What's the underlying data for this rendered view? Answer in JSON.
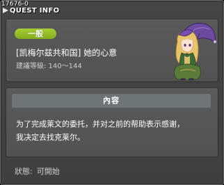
{
  "window": {
    "quest_id": "17676-0",
    "title": "QUEST INFO"
  },
  "info": {
    "category": "一般",
    "quest_title": "[凯梅尔兹共和国] 她的心意",
    "level_requirement": "建議等級: 140～144",
    "npc_icon": "npc-portrait-girl-with-umbrella"
  },
  "content": {
    "header": "內容",
    "lines": [
      "为了完成莱文的委托，并对之前的帮助表示感谢，",
      "我决定去找克莱尔。"
    ]
  },
  "status": {
    "label": "狀態:",
    "value": "可開始"
  }
}
